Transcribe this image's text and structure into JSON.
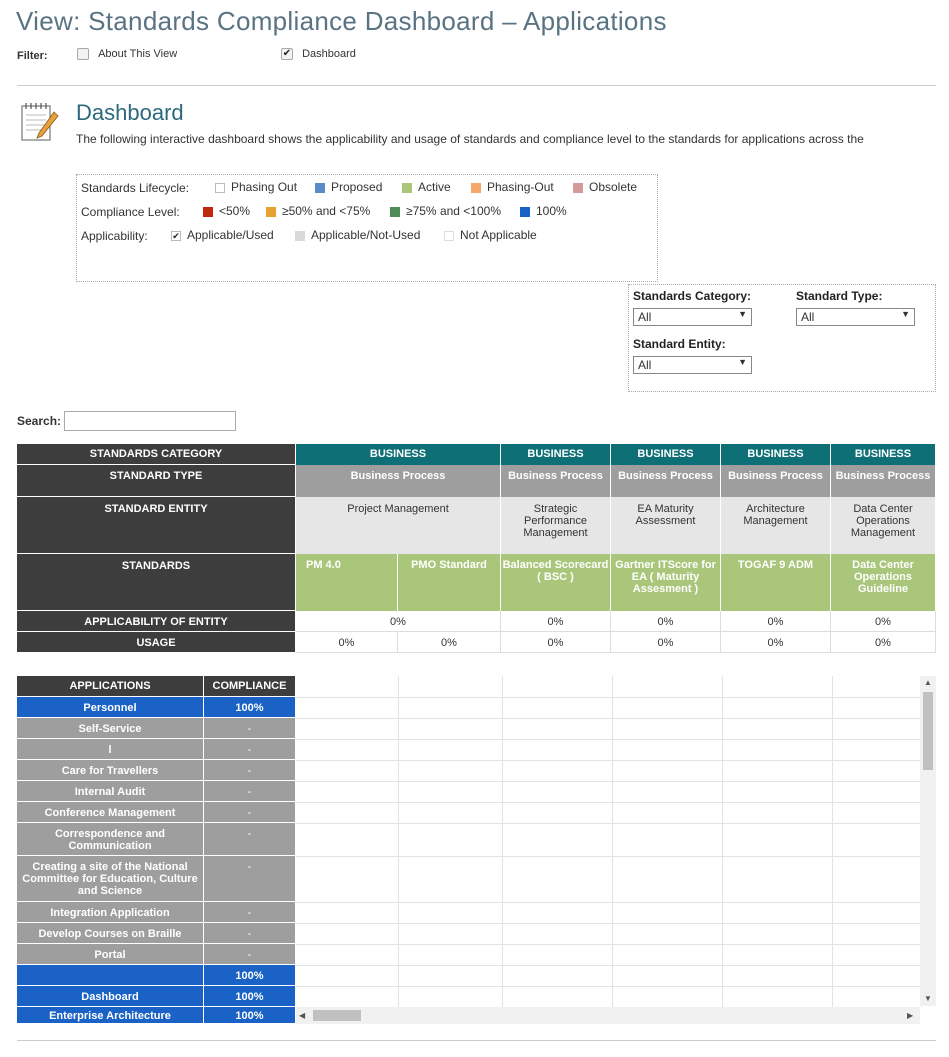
{
  "title": "View: Standards Compliance Dashboard – Applications",
  "filter": {
    "label": "Filter:",
    "options": [
      {
        "label": "About This View",
        "checked": false
      },
      {
        "label": "Dashboard",
        "checked": true
      }
    ]
  },
  "dashboard": {
    "title": "Dashboard",
    "description": "The following interactive dashboard shows the applicability and usage of standards and compliance level to the  standards for applications across the"
  },
  "legend": {
    "lifecycle": {
      "label": "Standards Lifecycle:",
      "items": [
        {
          "label": "Phasing Out",
          "color": "#ffffff"
        },
        {
          "label": "Proposed",
          "color": "#5b8cc9"
        },
        {
          "label": "Active",
          "color": "#a9c67b"
        },
        {
          "label": "Phasing-Out",
          "color": "#f4a96a"
        },
        {
          "label": "Obsolete",
          "color": "#d39a9a"
        }
      ]
    },
    "compliance": {
      "label": "Compliance Level:",
      "items": [
        {
          "label": "<50%",
          "color": "#c0270f"
        },
        {
          "label": "≥50% and <75%",
          "color": "#e8a232"
        },
        {
          "label": "≥75% and <100%",
          "color": "#4f8c57"
        },
        {
          "label": "100%",
          "color": "#1a62c5"
        }
      ]
    },
    "applicability": {
      "label": "Applicability:",
      "items": [
        {
          "label": "Applicable/Used",
          "check": "✔"
        },
        {
          "label": "Applicable/Not-Used"
        },
        {
          "label": "Not Applicable"
        }
      ]
    }
  },
  "selectors": {
    "category": {
      "label": "Standards Category:",
      "value": "All"
    },
    "type": {
      "label": "Standard Type:",
      "value": "All"
    },
    "entity": {
      "label": "Standard Entity:",
      "value": "All"
    }
  },
  "search": {
    "label": "Search:",
    "value": ""
  },
  "matrix": {
    "row_headers": {
      "category": "STANDARDS CATEGORY",
      "type": "STANDARD TYPE",
      "entity": "STANDARD ENTITY",
      "standards": "STANDARDS",
      "applicability": "APPLICABILITY OF ENTITY",
      "usage": "USAGE"
    },
    "columns": [
      {
        "category": "BUSINESS",
        "type": "Business Process",
        "entity": "Project Management",
        "standards": [
          "PM 4.0",
          "PMO Standard"
        ],
        "applicability": "0%",
        "usage": [
          "0%",
          "0%"
        ]
      },
      {
        "category": "BUSINESS",
        "type": "Business Process",
        "entity": "Strategic Performance Management",
        "standards": [
          "Balanced Scorecard ( BSC )"
        ],
        "applicability": "0%",
        "usage": [
          "0%"
        ]
      },
      {
        "category": "BUSINESS",
        "type": "Business Process",
        "entity": "EA Maturity Assessment",
        "standards": [
          "Gartner ITScore for EA ( Maturity Assesment )"
        ],
        "applicability": "0%",
        "usage": [
          "0%"
        ]
      },
      {
        "category": "BUSINESS",
        "type": "Business Process",
        "entity": "Architecture Management",
        "standards": [
          "TOGAF 9 ADM"
        ],
        "applicability": "0%",
        "usage": [
          "0%"
        ]
      },
      {
        "category": "BUSINESS",
        "type": "Business Process",
        "entity": "Data Center Operations Management",
        "standards": [
          "Data Center Operations Guideline"
        ],
        "applicability": "0%",
        "usage": [
          "0%"
        ]
      }
    ]
  },
  "applications": {
    "headers": {
      "name": "APPLICATIONS",
      "compliance": "COMPLIANCE"
    },
    "rows": [
      {
        "name": "Personnel",
        "compliance": "100%",
        "status": "blue"
      },
      {
        "name": "Self-Service",
        "compliance": "-",
        "status": "gray"
      },
      {
        "name": "l",
        "compliance": "-",
        "status": "gray"
      },
      {
        "name": "Care for Travellers",
        "compliance": "-",
        "status": "gray"
      },
      {
        "name": "Internal Audit",
        "compliance": "-",
        "status": "gray"
      },
      {
        "name": "Conference Management",
        "compliance": "-",
        "status": "gray"
      },
      {
        "name": "Correspondence and Communication",
        "compliance": "-",
        "status": "gray"
      },
      {
        "name": "Creating a site of the National Committee for Education, Culture and Science",
        "compliance": "-",
        "status": "gray"
      },
      {
        "name": "Integration Application",
        "compliance": "-",
        "status": "gray"
      },
      {
        "name": "Develop Courses on Braille",
        "compliance": "-",
        "status": "gray"
      },
      {
        "name": "Portal",
        "compliance": "-",
        "status": "gray"
      },
      {
        "name": "",
        "compliance": "100%",
        "status": "blue"
      },
      {
        "name": "Dashboard",
        "compliance": "100%",
        "status": "blue"
      },
      {
        "name": "Enterprise Architecture",
        "compliance": "100%",
        "status": "blue"
      }
    ]
  }
}
